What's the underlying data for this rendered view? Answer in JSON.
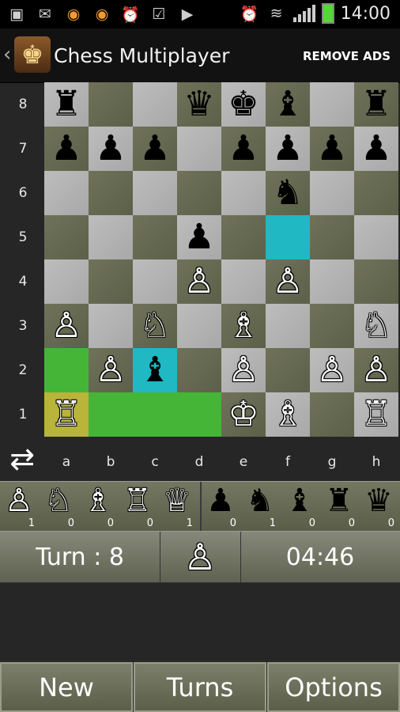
{
  "status_bar": {
    "time": "14:00",
    "icons": [
      "gallery-icon",
      "mail-icon",
      "app-icon",
      "app-icon",
      "alarm-icon",
      "clipboard-icon",
      "play-store-icon"
    ],
    "right_icons": [
      "alarm-icon",
      "wifi-icon",
      "signal-icon",
      "battery-icon"
    ]
  },
  "app_bar": {
    "title": "Chess Multiplayer",
    "remove_ads": "REMOVE ADS"
  },
  "board": {
    "ranks": [
      "8",
      "7",
      "6",
      "5",
      "4",
      "3",
      "2",
      "1"
    ],
    "files": [
      "a",
      "b",
      "c",
      "d",
      "e",
      "f",
      "g",
      "h"
    ],
    "rows": [
      [
        "♜",
        "",
        "",
        "♛",
        "♚",
        "♝",
        "",
        "♜"
      ],
      [
        "♟",
        "♟",
        "♟",
        "",
        "♟",
        "♟",
        "♟",
        "♟"
      ],
      [
        "",
        "",
        "",
        "",
        "",
        "♞",
        "",
        ""
      ],
      [
        "",
        "",
        "",
        "♟",
        "",
        "",
        "",
        ""
      ],
      [
        "",
        "",
        "",
        "♙",
        "",
        "♙",
        "",
        ""
      ],
      [
        "♙",
        "",
        "♘",
        "",
        "♗",
        "",
        "",
        "♘"
      ],
      [
        "",
        "♙",
        "♝",
        "",
        "♙",
        "",
        "♙",
        "♙"
      ],
      [
        "♖",
        "",
        "",
        "",
        "♔",
        "♗",
        "",
        "♖"
      ]
    ],
    "highlight_cyan": [
      "f5",
      "c2"
    ],
    "highlight_green": [
      "a2",
      "b1",
      "c1",
      "d1"
    ],
    "highlight_yellow": [
      "a1"
    ]
  },
  "captured": {
    "white": [
      {
        "piece": "♙",
        "count": "1"
      },
      {
        "piece": "♘",
        "count": "0"
      },
      {
        "piece": "♗",
        "count": "0"
      },
      {
        "piece": "♖",
        "count": "0"
      },
      {
        "piece": "♕",
        "count": "1"
      }
    ],
    "black": [
      {
        "piece": "♟",
        "count": "0"
      },
      {
        "piece": "♞",
        "count": "1"
      },
      {
        "piece": "♝",
        "count": "0"
      },
      {
        "piece": "♜",
        "count": "0"
      },
      {
        "piece": "♛",
        "count": "0"
      }
    ]
  },
  "turn": {
    "label": "Turn : 8",
    "player_piece": "♙",
    "timer": "04:46"
  },
  "buttons": {
    "new": "New",
    "turns": "Turns",
    "options": "Options"
  },
  "colors": {
    "highlight_cyan": "#1fb8c3",
    "highlight_green": "#45b537",
    "highlight_yellow": "#b9b43a"
  }
}
